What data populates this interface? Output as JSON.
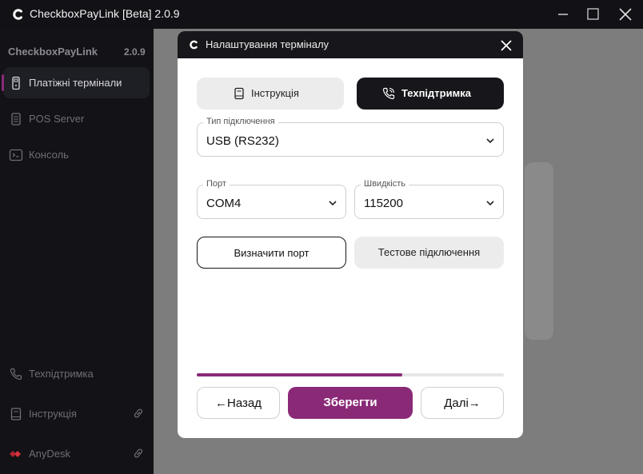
{
  "window": {
    "title": "CheckboxPayLink [Beta] 2.0.9",
    "controls": {
      "minimize": "minimize-icon",
      "maximize": "maximize-icon",
      "close": "close-icon"
    }
  },
  "sidebar": {
    "brand": "CheckboxPayLink",
    "version": "2.0.9",
    "items": [
      {
        "label": "Платіжні термінали",
        "icon": "payment-terminal-icon",
        "active": true
      },
      {
        "label": "POS Server",
        "icon": "pos-server-icon",
        "active": false
      },
      {
        "label": "Консоль",
        "icon": "console-icon",
        "active": false
      }
    ],
    "bottom_items": [
      {
        "label": "Техпідтримка",
        "icon": "phone-icon"
      },
      {
        "label": "Інструкція",
        "icon": "book-icon",
        "link_icon": "external-link-icon"
      },
      {
        "label": "AnyDesk",
        "icon": "anydesk-icon",
        "link_icon": "external-link-icon"
      }
    ]
  },
  "dialog": {
    "title": "Налаштування терміналу",
    "instruction_button": "Інструкція",
    "support_button": "Техпідтримка",
    "connection": {
      "label": "Тип підключення",
      "value": "USB (RS232)"
    },
    "port": {
      "label": "Порт",
      "value": "COM4"
    },
    "speed": {
      "label": "Швидкість",
      "value": "115200"
    },
    "detect_port_button": "Визначити порт",
    "test_connection_button": "Тестове підключення",
    "progress": 0.67,
    "back_button": "←Назад",
    "save_button": "Зберегти",
    "next_button": "Далі→"
  },
  "colors": {
    "accent": "#8a2a77",
    "dark": "#16161b",
    "overlay": "#7d7d7d"
  }
}
